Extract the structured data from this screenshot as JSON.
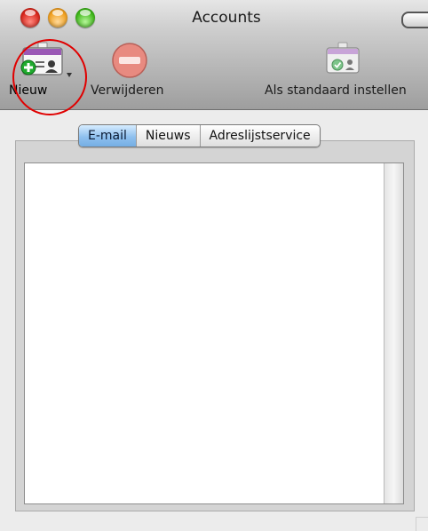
{
  "window": {
    "title": "Accounts"
  },
  "toolbar": {
    "items": [
      {
        "label": "Nieuw",
        "icon": "new-account-card-icon",
        "has_dropdown": true
      },
      {
        "label": "Verwijderen",
        "icon": "delete-minus-icon",
        "enabled": false
      },
      {
        "label": "Als standaard instellen",
        "icon": "default-account-card-icon",
        "enabled": false
      }
    ]
  },
  "tabs": [
    {
      "label": "E-mail",
      "selected": true
    },
    {
      "label": "Nieuws",
      "selected": false
    },
    {
      "label": "Adreslijstservice",
      "selected": false
    }
  ],
  "colors": {
    "annotation": "#e00000",
    "selected_tab": "#8fc0ee"
  }
}
